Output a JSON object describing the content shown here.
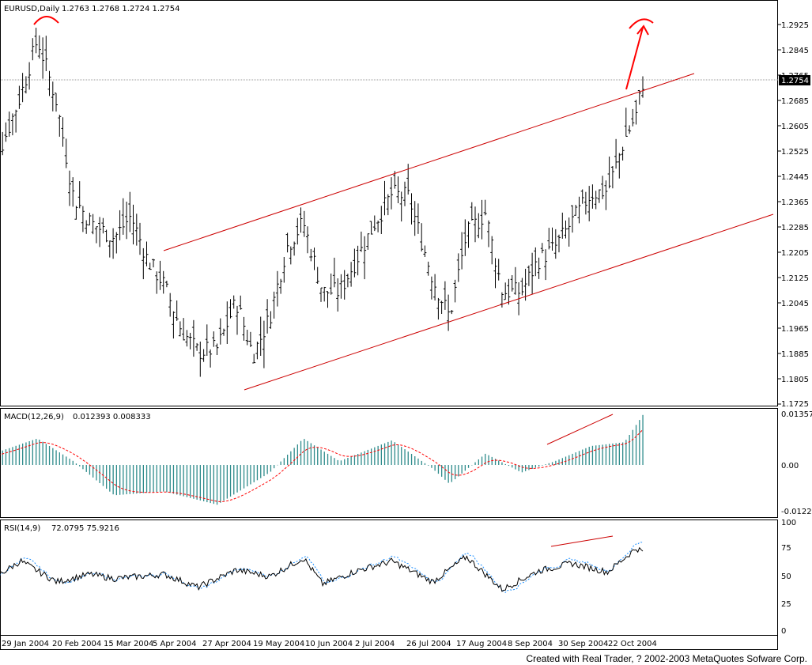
{
  "main_panel": {
    "header": {
      "symbol_period": "EURUSD,Daily",
      "ohlc": "1.2763 1.2768 1.2724 1.2754"
    },
    "price_ticks": [
      "1.2925",
      "1.2845",
      "1.2765",
      "1.2685",
      "1.2605",
      "1.2525",
      "1.2445",
      "1.2365",
      "1.2285",
      "1.2205",
      "1.2125",
      "1.2045",
      "1.1965",
      "1.1885",
      "1.1805",
      "1.1725"
    ],
    "current_price_label": "1.2754"
  },
  "macd_panel": {
    "header": {
      "name": "MACD(12,26,9)",
      "values": "0.012393 0.008333"
    },
    "ticks": [
      "0.01357",
      "0.00",
      "-0.0122"
    ]
  },
  "rsi_panel": {
    "header": {
      "name": "RSI(14,9)",
      "values": "72.0795 75.9216"
    },
    "ticks": [
      "100",
      "75",
      "50",
      "25",
      "0"
    ]
  },
  "date_labels": [
    "29 Jan 2004",
    "20 Feb 2004",
    "15 Mar 2004",
    "5 Apr 2004",
    "27 Apr 2004",
    "19 May 2004",
    "10 Jun 2004",
    "2 Jul 2004",
    "26 Jul 2004",
    "17 Aug 2004",
    "8 Sep 2004",
    "30 Sep 2004",
    "22 Oct 2004"
  ],
  "footer": {
    "credit": "Created with Real Trader, ? 2002-2003 MetaQuotes Sofware Corp."
  },
  "colors": {
    "bars": "#000000",
    "trendline": "#cc0000",
    "histogram": "#2e8b8b",
    "signal": "#ff0000",
    "rsi_dotted": "#1e90ff",
    "price_label_bg": "#000000"
  },
  "chart_data": [
    {
      "type": "ohlc",
      "title": "EURUSD,Daily",
      "x_labels": [
        "29 Jan 2004",
        "20 Feb 2004",
        "15 Mar 2004",
        "5 Apr 2004",
        "27 Apr 2004",
        "19 May 2004",
        "10 Jun 2004",
        "2 Jul 2004",
        "26 Jul 2004",
        "17 Aug 2004",
        "8 Sep 2004",
        "30 Sep 2004",
        "22 Oct 2004"
      ],
      "ylim": [
        1.1725,
        1.2965
      ],
      "approx_close_path": [
        {
          "date": "2004-01-20",
          "close": 1.242
        },
        {
          "date": "2004-01-29",
          "close": 1.256
        },
        {
          "date": "2004-02-05",
          "close": 1.27
        },
        {
          "date": "2004-02-12",
          "close": 1.288
        },
        {
          "date": "2004-02-20",
          "close": 1.268
        },
        {
          "date": "2004-02-27",
          "close": 1.238
        },
        {
          "date": "2004-03-05",
          "close": 1.23
        },
        {
          "date": "2004-03-15",
          "close": 1.225
        },
        {
          "date": "2004-03-22",
          "close": 1.232
        },
        {
          "date": "2004-03-29",
          "close": 1.218
        },
        {
          "date": "2004-04-05",
          "close": 1.21
        },
        {
          "date": "2004-04-12",
          "close": 1.196
        },
        {
          "date": "2004-04-19",
          "close": 1.189
        },
        {
          "date": "2004-04-27",
          "close": 1.19
        },
        {
          "date": "2004-05-05",
          "close": 1.205
        },
        {
          "date": "2004-05-12",
          "close": 1.188
        },
        {
          "date": "2004-05-19",
          "close": 1.2
        },
        {
          "date": "2004-05-26",
          "close": 1.222
        },
        {
          "date": "2004-06-02",
          "close": 1.23
        },
        {
          "date": "2004-06-10",
          "close": 1.208
        },
        {
          "date": "2004-06-17",
          "close": 1.208
        },
        {
          "date": "2004-06-24",
          "close": 1.218
        },
        {
          "date": "2004-07-02",
          "close": 1.23
        },
        {
          "date": "2004-07-09",
          "close": 1.239
        },
        {
          "date": "2004-07-16",
          "close": 1.238
        },
        {
          "date": "2004-07-26",
          "close": 1.212
        },
        {
          "date": "2004-08-02",
          "close": 1.2
        },
        {
          "date": "2004-08-09",
          "close": 1.226
        },
        {
          "date": "2004-08-17",
          "close": 1.233
        },
        {
          "date": "2004-08-24",
          "close": 1.208
        },
        {
          "date": "2004-09-01",
          "close": 1.208
        },
        {
          "date": "2004-09-08",
          "close": 1.218
        },
        {
          "date": "2004-09-15",
          "close": 1.222
        },
        {
          "date": "2004-09-22",
          "close": 1.23
        },
        {
          "date": "2004-09-30",
          "close": 1.239
        },
        {
          "date": "2004-10-07",
          "close": 1.24
        },
        {
          "date": "2004-10-14",
          "close": 1.256
        },
        {
          "date": "2004-10-19",
          "close": 1.264
        },
        {
          "date": "2004-10-22",
          "close": 1.2754
        }
      ],
      "channel_lines": [
        {
          "name": "upper",
          "from": {
            "date": "2004-04-08",
            "price": 1.2215
          },
          "to": {
            "date": "2004-11-05",
            "price": 1.276
          }
        },
        {
          "name": "lower",
          "from": {
            "date": "2004-05-01",
            "price": 1.178
          },
          "to": {
            "date": "2004-11-25",
            "price": 1.232
          }
        }
      ],
      "current_price": 1.2754
    },
    {
      "type": "bar",
      "title": "MACD(12,26,9)",
      "ylim": [
        -0.0122,
        0.01357
      ],
      "values_shown": {
        "macd": 0.012393,
        "signal": 0.008333
      },
      "approx_histogram_path": [
        {
          "date": "2004-01-20",
          "value": 0.002
        },
        {
          "date": "2004-02-12",
          "value": 0.007
        },
        {
          "date": "2004-02-27",
          "value": 0.001
        },
        {
          "date": "2004-03-15",
          "value": -0.008
        },
        {
          "date": "2004-04-05",
          "value": -0.007
        },
        {
          "date": "2004-04-27",
          "value": -0.0105
        },
        {
          "date": "2004-05-19",
          "value": -0.002
        },
        {
          "date": "2004-06-02",
          "value": 0.007
        },
        {
          "date": "2004-06-17",
          "value": 0.001
        },
        {
          "date": "2004-07-09",
          "value": 0.0065
        },
        {
          "date": "2004-07-26",
          "value": -0.001
        },
        {
          "date": "2004-08-02",
          "value": -0.005
        },
        {
          "date": "2004-08-17",
          "value": 0.003
        },
        {
          "date": "2004-09-01",
          "value": -0.002
        },
        {
          "date": "2004-09-15",
          "value": 0.001
        },
        {
          "date": "2004-09-30",
          "value": 0.005
        },
        {
          "date": "2004-10-14",
          "value": 0.006
        },
        {
          "date": "2004-10-22",
          "value": 0.0135
        }
      ]
    },
    {
      "type": "line",
      "title": "RSI(14,9)",
      "ylim": [
        0,
        100
      ],
      "values_shown": {
        "rsi": 72.0795,
        "signal": 75.9216
      },
      "approx_rsi_path": [
        {
          "date": "2004-01-20",
          "value": 42
        },
        {
          "date": "2004-02-05",
          "value": 64
        },
        {
          "date": "2004-02-20",
          "value": 45
        },
        {
          "date": "2004-03-05",
          "value": 52
        },
        {
          "date": "2004-03-15",
          "value": 48
        },
        {
          "date": "2004-04-05",
          "value": 52
        },
        {
          "date": "2004-04-19",
          "value": 40
        },
        {
          "date": "2004-05-05",
          "value": 56
        },
        {
          "date": "2004-05-19",
          "value": 50
        },
        {
          "date": "2004-06-02",
          "value": 67
        },
        {
          "date": "2004-06-10",
          "value": 43
        },
        {
          "date": "2004-06-24",
          "value": 55
        },
        {
          "date": "2004-07-09",
          "value": 64
        },
        {
          "date": "2004-07-26",
          "value": 45
        },
        {
          "date": "2004-08-09",
          "value": 68
        },
        {
          "date": "2004-08-24",
          "value": 38
        },
        {
          "date": "2004-09-08",
          "value": 55
        },
        {
          "date": "2004-09-22",
          "value": 62
        },
        {
          "date": "2004-10-07",
          "value": 54
        },
        {
          "date": "2004-10-19",
          "value": 76
        },
        {
          "date": "2004-10-22",
          "value": 72
        }
      ]
    }
  ]
}
